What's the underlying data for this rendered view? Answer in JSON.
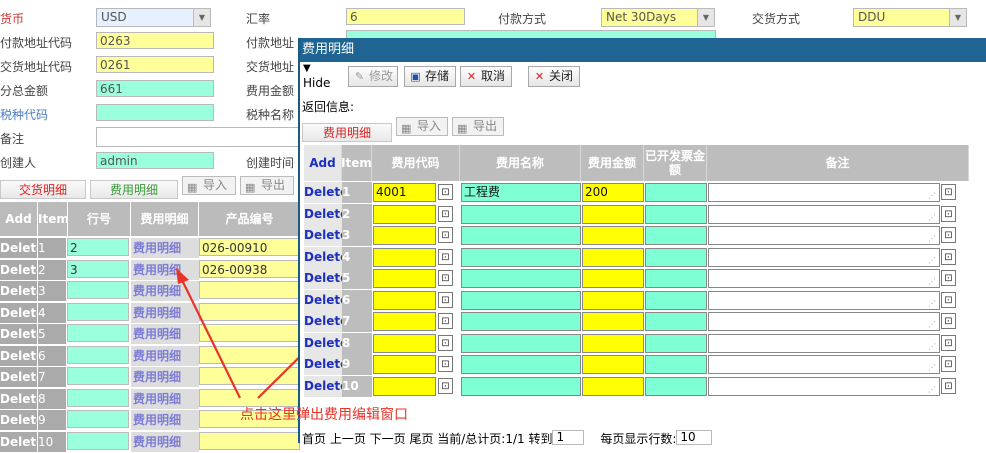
{
  "form": {
    "currency_label": "货币",
    "currency_value": "USD",
    "rate_label": "汇率",
    "rate_value": "6",
    "pay_method_label": "付款方式",
    "pay_method_value": "Net 30Days",
    "delivery_method_label": "交货方式",
    "delivery_method_value": "DDU",
    "pay_addr_code_label": "付款地址代码",
    "pay_addr_code_value": "0263",
    "pay_addr_label": "付款地址",
    "del_addr_code_label": "交货地址代码",
    "del_addr_code_value": "0261",
    "del_addr_label": "交货地址",
    "subtotal_label": "分总金额",
    "subtotal_value": "661",
    "fee_total_label": "费用金额",
    "tax_code_label": "税种代码",
    "tax_name_label": "税种名称",
    "remark_label": "备注",
    "creator_label": "创建人",
    "creator_value": "admin",
    "create_time_label": "创建时间"
  },
  "bg_tabs": {
    "delivery": "交货明细",
    "fee": "费用明细",
    "import": "导入",
    "export": "导出"
  },
  "bg_grid": {
    "headers": [
      "Add",
      "Item",
      "行号",
      "费用明细",
      "产品编号"
    ],
    "rows": [
      {
        "del": "Delete",
        "item": "1",
        "line": "2",
        "link": "费用明细",
        "code": "026-00910"
      },
      {
        "del": "Delete",
        "item": "2",
        "line": "3",
        "link": "费用明细",
        "code": "026-00938"
      },
      {
        "del": "Delete",
        "item": "3",
        "line": "",
        "link": "费用明细",
        "code": ""
      },
      {
        "del": "Delete",
        "item": "4",
        "line": "",
        "link": "费用明细",
        "code": ""
      },
      {
        "del": "Delete",
        "item": "5",
        "line": "",
        "link": "费用明细",
        "code": ""
      },
      {
        "del": "Delete",
        "item": "6",
        "line": "",
        "link": "费用明细",
        "code": ""
      },
      {
        "del": "Delete",
        "item": "7",
        "line": "",
        "link": "费用明细",
        "code": ""
      },
      {
        "del": "Delete",
        "item": "8",
        "line": "",
        "link": "费用明细",
        "code": ""
      },
      {
        "del": "Delete",
        "item": "9",
        "line": "",
        "link": "费用明细",
        "code": ""
      },
      {
        "del": "Delete",
        "item": "10",
        "line": "",
        "link": "费用明细",
        "code": ""
      }
    ]
  },
  "annotation": "点击这里弹出费用编辑窗口",
  "dialog": {
    "title": "费用明细",
    "hide_label": "Hide",
    "toolbar": {
      "edit": "修改",
      "save": "存储",
      "cancel": "取消",
      "close": "关闭"
    },
    "return_info_label": "返回信息:",
    "tabs": {
      "fee": "费用明细",
      "import": "导入",
      "export": "导出"
    },
    "headers": [
      "Add",
      "Item",
      "费用代码",
      "费用名称",
      "费用金额",
      "已开发票金额",
      "备注"
    ],
    "rows": [
      {
        "del": "Delete",
        "item": "1",
        "code": "4001",
        "name": "工程费",
        "amount": "200",
        "invoiced": "",
        "remark": ""
      },
      {
        "del": "Delete",
        "item": "2",
        "code": "",
        "name": "",
        "amount": "",
        "invoiced": "",
        "remark": ""
      },
      {
        "del": "Delete",
        "item": "3",
        "code": "",
        "name": "",
        "amount": "",
        "invoiced": "",
        "remark": ""
      },
      {
        "del": "Delete",
        "item": "4",
        "code": "",
        "name": "",
        "amount": "",
        "invoiced": "",
        "remark": ""
      },
      {
        "del": "Delete",
        "item": "5",
        "code": "",
        "name": "",
        "amount": "",
        "invoiced": "",
        "remark": ""
      },
      {
        "del": "Delete",
        "item": "6",
        "code": "",
        "name": "",
        "amount": "",
        "invoiced": "",
        "remark": ""
      },
      {
        "del": "Delete",
        "item": "7",
        "code": "",
        "name": "",
        "amount": "",
        "invoiced": "",
        "remark": ""
      },
      {
        "del": "Delete",
        "item": "8",
        "code": "",
        "name": "",
        "amount": "",
        "invoiced": "",
        "remark": ""
      },
      {
        "del": "Delete",
        "item": "9",
        "code": "",
        "name": "",
        "amount": "",
        "invoiced": "",
        "remark": ""
      },
      {
        "del": "Delete",
        "item": "10",
        "code": "",
        "name": "",
        "amount": "",
        "invoiced": "",
        "remark": ""
      }
    ],
    "pager": {
      "text": "首页 上一页 下一页 尾页 当前/总计页:1/1 转到",
      "goto_value": "1",
      "rows_label": "每页显示行数:",
      "rows_value": "10"
    }
  },
  "colors": {
    "title_bar": "#1f6492",
    "yellow": "#ffff00",
    "aqua": "#7fffd4",
    "annotation_red": "#e8332a"
  }
}
